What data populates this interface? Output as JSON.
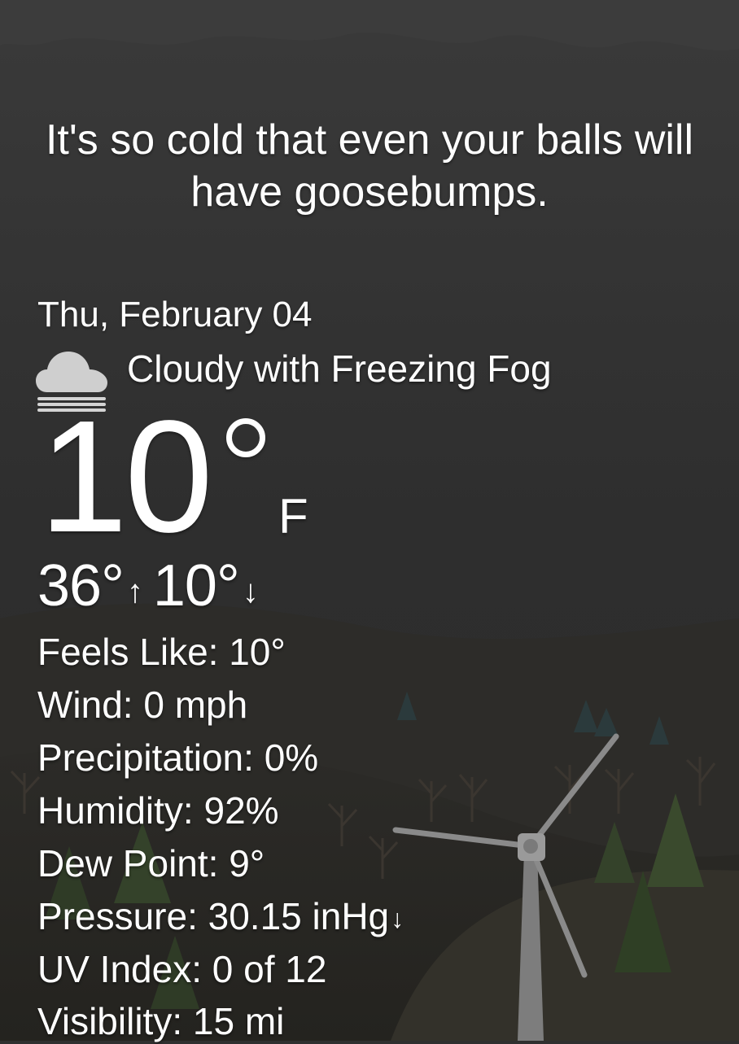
{
  "quote": "It's so cold that even your balls will have goosebumps.",
  "date": "Thu, February 04",
  "condition": {
    "icon": "cloud-fog-icon",
    "text": "Cloudy with Freezing Fog"
  },
  "temperature": {
    "current": "10",
    "unit": "F",
    "high": "36°",
    "low": "10°",
    "high_arrow": "↑",
    "low_arrow": "↓"
  },
  "details": {
    "feels_like": "Feels Like: 10°",
    "wind": "Wind: 0 mph",
    "precipitation": "Precipitation: 0%",
    "humidity": "Humidity: 92%",
    "dew_point": "Dew Point: 9°",
    "pressure": "Pressure: 30.15 inHg",
    "pressure_trend": "↓",
    "uv_index": "UV Index: 0 of 12",
    "visibility": "Visibility: 15 mi"
  },
  "colors": {
    "sky": "#2f2f2f",
    "hills": "#2a2925",
    "text": "#ffffff",
    "trees_green": "#3a4a2a",
    "turbine": "#8c8c8c"
  }
}
